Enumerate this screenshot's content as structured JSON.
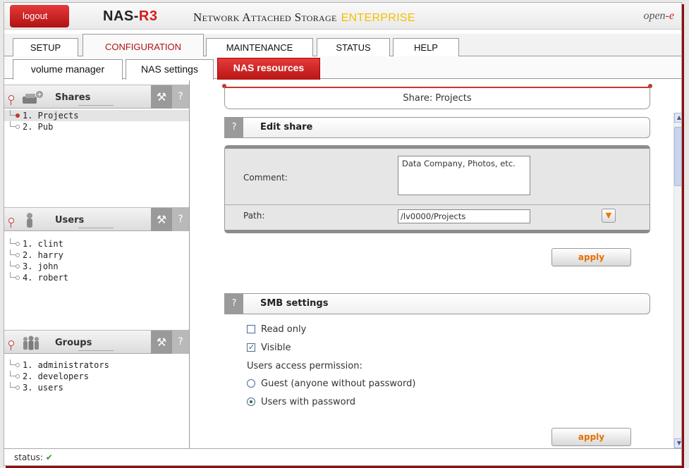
{
  "header": {
    "logout_label": "logout",
    "brand_part1": "NAS-",
    "brand_part2": "R3",
    "tagline": "Network Attached Storage",
    "tagline_edition": "ENTERPRISE",
    "corner_logo_part1": "open-",
    "corner_logo_part2": "e"
  },
  "main_tabs": [
    {
      "label": "SETUP",
      "active": false
    },
    {
      "label": "CONFIGURATION",
      "active": true
    },
    {
      "label": "MAINTENANCE",
      "active": false
    },
    {
      "label": "STATUS",
      "active": false
    },
    {
      "label": "HELP",
      "active": false
    }
  ],
  "sub_tabs": [
    {
      "label": "volume manager",
      "active": false
    },
    {
      "label": "NAS settings",
      "active": false
    },
    {
      "label": "NAS resources",
      "active": true
    }
  ],
  "left": {
    "shares": {
      "title": "Shares",
      "items": [
        "1. Projects",
        "2. Pub"
      ],
      "selected_index": 0
    },
    "users": {
      "title": "Users",
      "items": [
        "1. clint",
        "2. harry",
        "3. john",
        "4. robert"
      ]
    },
    "groups": {
      "title": "Groups",
      "items": [
        "1. administrators",
        "2. developers",
        "3. users"
      ]
    },
    "wrench_glyph": "⚒",
    "help_glyph": "?"
  },
  "share_title": "Share: Projects",
  "edit_share": {
    "help_glyph": "?",
    "title": "Edit share",
    "comment_label": "Comment:",
    "comment_value": "Data Company, Photos, etc.",
    "path_label": "Path:",
    "path_value": "/lv0000/Projects",
    "apply_label": "apply"
  },
  "smb_settings": {
    "help_glyph": "?",
    "title": "SMB settings",
    "read_only_label": "Read only",
    "read_only_checked": false,
    "visible_label": "Visible",
    "visible_checked": true,
    "access_label": "Users access permission:",
    "guest_label": "Guest (anyone without password)",
    "users_label": "Users with password",
    "selected_access": "users",
    "apply_label": "apply"
  },
  "status": {
    "label": "status:",
    "icon": "check-icon",
    "glyph": "✔",
    "color": "#2a9a2a"
  },
  "colors": {
    "brand_red": "#b01212",
    "accent_orange": "#e67000",
    "enterprise_yellow": "#f3c000"
  }
}
